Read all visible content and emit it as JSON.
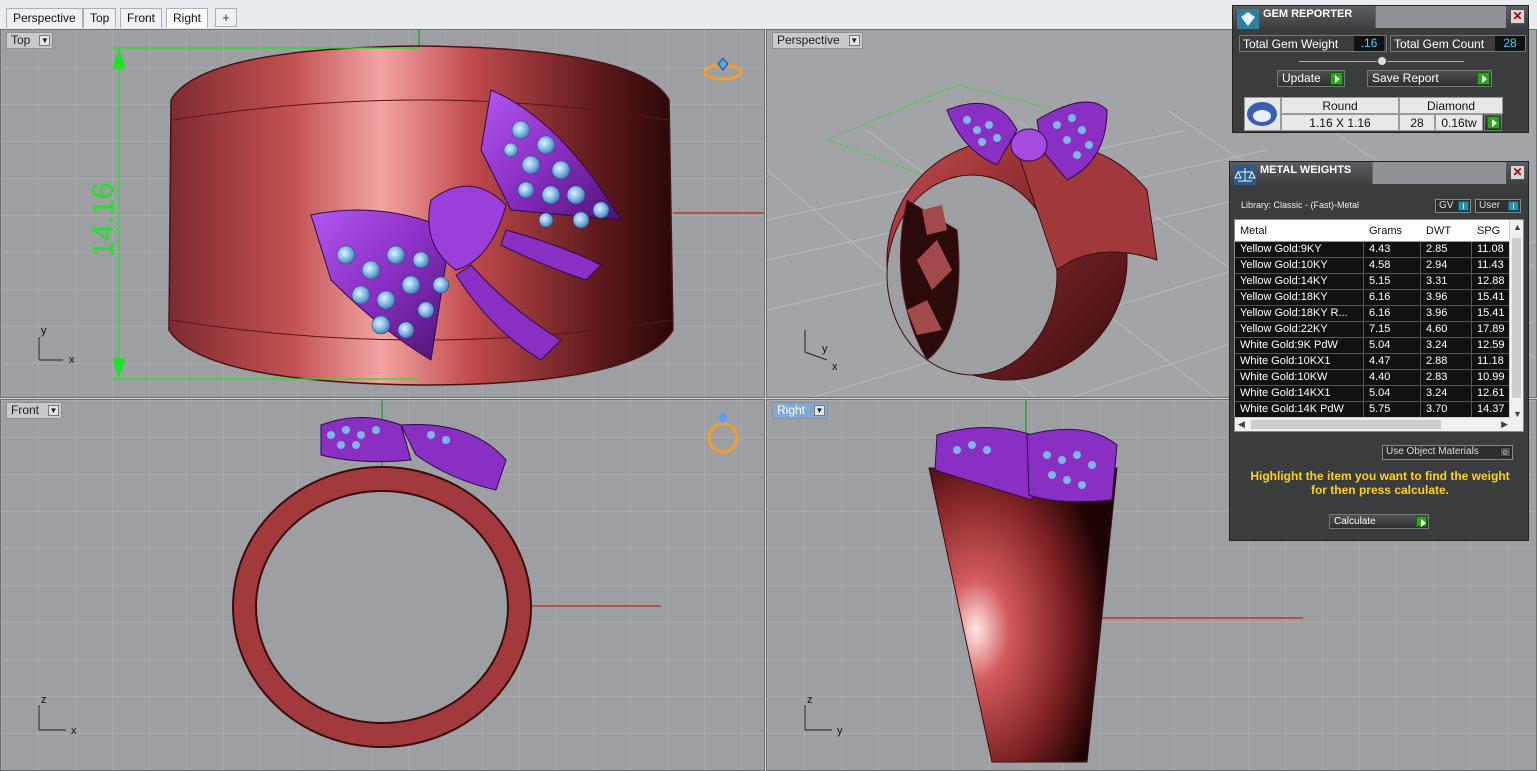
{
  "tabs": [
    {
      "label": "Perspective",
      "active": false
    },
    {
      "label": "Top",
      "active": false
    },
    {
      "label": "Front",
      "active": false
    },
    {
      "label": "Right",
      "active": true
    }
  ],
  "viewports": {
    "top": {
      "label": "Top",
      "dimension": "14.16",
      "axis_x": "x",
      "axis_y": "y"
    },
    "perspective": {
      "label": "Perspective",
      "axis_x": "x",
      "axis_y": "y"
    },
    "front": {
      "label": "Front",
      "axis_x": "x",
      "axis_y": "z"
    },
    "right": {
      "label": "Right",
      "axis_x": "y",
      "axis_y": "z"
    }
  },
  "gem_reporter": {
    "title": "GEM REPORTER",
    "total_weight_label": "Total Gem Weight",
    "total_weight_value": ".16",
    "total_count_label": "Total Gem Count",
    "total_count_value": "28",
    "update_label": "Update",
    "save_label": "Save Report",
    "gem": {
      "shape": "Round",
      "material": "Diamond",
      "size": "1.16 X 1.16",
      "count": "28",
      "weight": "0.16tw"
    }
  },
  "metal_weights": {
    "title": "METAL WEIGHTS",
    "library": "Library: Classic - (Fast)-Metal",
    "gv_label": "GV",
    "user_label": "User",
    "columns": [
      "Metal",
      "Grams",
      "DWT",
      "SPG"
    ],
    "rows": [
      [
        "Yellow Gold:9KY",
        "4.43",
        "2.85",
        "11.08"
      ],
      [
        "Yellow Gold:10KY",
        "4.58",
        "2.94",
        "11.43"
      ],
      [
        "Yellow Gold:14KY",
        "5.15",
        "3.31",
        "12.88"
      ],
      [
        "Yellow Gold:18KY",
        "6.16",
        "3.96",
        "15.41"
      ],
      [
        "Yellow Gold:18KY R...",
        "6.16",
        "3.96",
        "15.41"
      ],
      [
        "Yellow Gold:22KY",
        "7.15",
        "4.60",
        "17.89"
      ],
      [
        "White Gold:9K PdW",
        "5.04",
        "3.24",
        "12.59"
      ],
      [
        "White Gold:10KX1",
        "4.47",
        "2.88",
        "11.18"
      ],
      [
        "White Gold:10KW",
        "4.40",
        "2.83",
        "10.99"
      ],
      [
        "White Gold:14KX1",
        "5.04",
        "3.24",
        "12.61"
      ],
      [
        "White Gold:14K PdW",
        "5.75",
        "3.70",
        "14.37"
      ]
    ],
    "use_object_label": "Use Object Materials",
    "hint": "Highlight the item you want to find the weight for then press calculate.",
    "calculate_label": "Calculate"
  },
  "colors": {
    "metal": "#b8474a",
    "bow": "#8a2fc4",
    "gems": "#7fb6e8",
    "dimension": "#22e02a"
  }
}
